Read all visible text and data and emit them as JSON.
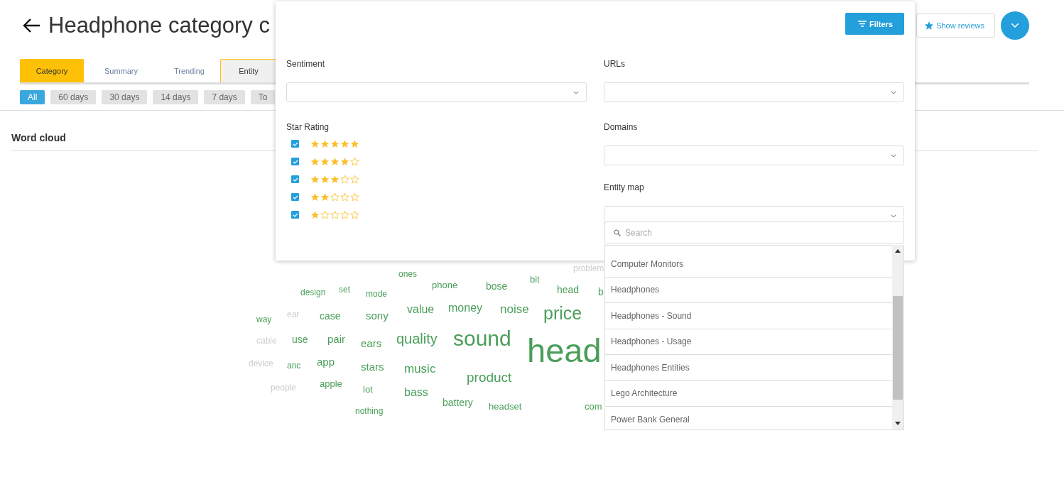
{
  "header": {
    "title": "Headphone category c",
    "show_reviews": "Show reviews"
  },
  "tabs": [
    {
      "label": "Category",
      "selected": true,
      "focused": false
    },
    {
      "label": "Summary",
      "selected": false,
      "focused": false
    },
    {
      "label": "Trending",
      "selected": false,
      "focused": false
    },
    {
      "label": "Entity",
      "selected": false,
      "focused": true
    }
  ],
  "periods": [
    {
      "label": "All",
      "selected": true
    },
    {
      "label": "60 days",
      "selected": false
    },
    {
      "label": "30 days",
      "selected": false
    },
    {
      "label": "14 days",
      "selected": false
    },
    {
      "label": "7 days",
      "selected": false
    },
    {
      "label": "To",
      "selected": false
    }
  ],
  "section": {
    "title": "Word cloud"
  },
  "word_cloud": [
    {
      "text": "ones",
      "color": "#4a9e59"
    },
    {
      "text": "problem",
      "color": "#cccccc"
    },
    {
      "text": "design",
      "color": "#4a9e59"
    },
    {
      "text": "set",
      "color": "#4a9e59"
    },
    {
      "text": "mode",
      "color": "#4a9e59"
    },
    {
      "text": "phone",
      "color": "#4a9e59"
    },
    {
      "text": "bose",
      "color": "#4a9e59"
    },
    {
      "text": "bit",
      "color": "#4a9e59"
    },
    {
      "text": "head",
      "color": "#4a9e59"
    },
    {
      "text": "b",
      "color": "#4a9e59"
    },
    {
      "text": "way",
      "color": "#4a9e59"
    },
    {
      "text": "ear",
      "color": "#cccccc"
    },
    {
      "text": "case",
      "color": "#4a9e59"
    },
    {
      "text": "sony",
      "color": "#4a9e59"
    },
    {
      "text": "value",
      "color": "#4a9e59"
    },
    {
      "text": "money",
      "color": "#4a9e59"
    },
    {
      "text": "noise",
      "color": "#4a9e59"
    },
    {
      "text": "price",
      "color": "#4a9e59"
    },
    {
      "text": "cable",
      "color": "#cccccc"
    },
    {
      "text": "use",
      "color": "#4a9e59"
    },
    {
      "text": "pair",
      "color": "#4a9e59"
    },
    {
      "text": "ears",
      "color": "#4a9e59"
    },
    {
      "text": "quality",
      "color": "#4a9e59"
    },
    {
      "text": "sound",
      "color": "#4a9e59"
    },
    {
      "text": "head",
      "color": "#4a9e59"
    },
    {
      "text": "device",
      "color": "#cccccc"
    },
    {
      "text": "anc",
      "color": "#4a9e59"
    },
    {
      "text": "app",
      "color": "#4a9e59"
    },
    {
      "text": "stars",
      "color": "#4a9e59"
    },
    {
      "text": "music",
      "color": "#4a9e59"
    },
    {
      "text": "product",
      "color": "#4a9e59"
    },
    {
      "text": "people",
      "color": "#cccccc"
    },
    {
      "text": "apple",
      "color": "#4a9e59"
    },
    {
      "text": "lot",
      "color": "#4a9e59"
    },
    {
      "text": "bass",
      "color": "#4a9e59"
    },
    {
      "text": "battery",
      "color": "#4a9e59"
    },
    {
      "text": "headset",
      "color": "#4a9e59"
    },
    {
      "text": "com",
      "color": "#4a9e59"
    },
    {
      "text": "nothing",
      "color": "#4a9e59"
    }
  ],
  "filters_panel": {
    "button": "Filters",
    "sentiment": {
      "label": "Sentiment"
    },
    "star_rating": {
      "label": "Star Rating",
      "options": [
        {
          "checked": true,
          "stars": 5
        },
        {
          "checked": true,
          "stars": 4
        },
        {
          "checked": true,
          "stars": 3
        },
        {
          "checked": true,
          "stars": 2
        },
        {
          "checked": true,
          "stars": 1
        }
      ]
    },
    "urls": {
      "label": "URLs"
    },
    "domains": {
      "label": "Domains"
    },
    "entity_map": {
      "label": "Entity map",
      "expanded": true,
      "search_placeholder": "Search",
      "options": [
        "Computer Monitors",
        "Headphones",
        "Headphones - Sound",
        "Headphones - Usage",
        "Headphones Entities",
        "Lego Architecture",
        "Power Bank General"
      ]
    }
  }
}
